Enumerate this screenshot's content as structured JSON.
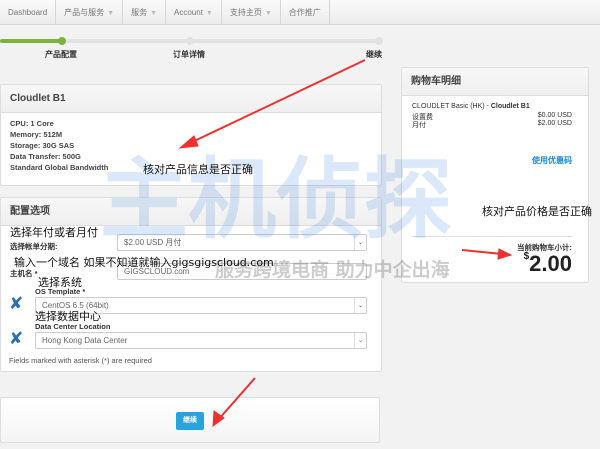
{
  "nav": {
    "items": [
      {
        "label": "Dashboard"
      },
      {
        "label": "产品与服务",
        "caret": true
      },
      {
        "label": "服务",
        "caret": true
      },
      {
        "label": "Account",
        "caret": true
      },
      {
        "label": "支持主页",
        "caret": true
      },
      {
        "label": "合作推广"
      }
    ]
  },
  "progress": {
    "steps": [
      "产品配置",
      "订单详情",
      "继续"
    ],
    "current": 1
  },
  "product": {
    "title": "Cloudlet B1",
    "specs": [
      "CPU: 1 Core",
      "Memory: 512M",
      "Storage: 30G SAS",
      "Data Transfer: 500G",
      "Standard Global Bandwidth"
    ]
  },
  "config": {
    "title": "配置选项",
    "billing": {
      "label": "选择帐单分期:",
      "value": "$2.00 USD 月付"
    },
    "hostname": {
      "label": "主机名 *",
      "value": "GIGSCLOUD.com"
    },
    "os": {
      "label": "OS Template *",
      "value": "CentOS 6.5 (64bit)"
    },
    "datacenter": {
      "label": "Data Center Location",
      "value": "Hong Kong Data Center"
    },
    "required_note": "Fields marked with asterisk (*) are required"
  },
  "continue_button": "继续",
  "cart": {
    "title": "购物车明细",
    "product": "CLOUDLET Basic (HK) - ",
    "product_bold": "Cloudlet B1",
    "lines": [
      {
        "label": "设置费",
        "value": "$0.00 USD"
      },
      {
        "label": "月付",
        "value": "$2.00 USD"
      }
    ],
    "promo_link": "使用优惠码",
    "subtotal_label": "当前购物车小计:",
    "currency": "$",
    "total": "2.00"
  },
  "annotations": {
    "check_product": "核对产品信息是否正确",
    "check_price": "核对产品价格是否正确",
    "billing": "选择年付或者月付",
    "hostname": "输入一个域名 如果不知道就输入gigsgigscloud.com",
    "os": "选择系统",
    "datacenter": "选择数据中心"
  },
  "watermark": {
    "logo": "主机侦探",
    "slogan": "服务跨境电商 助力中企出海"
  },
  "colors": {
    "accent": "#7bb33b",
    "link": "#1a8ad4",
    "button": "#29a3de",
    "arrow": "#f03030"
  }
}
